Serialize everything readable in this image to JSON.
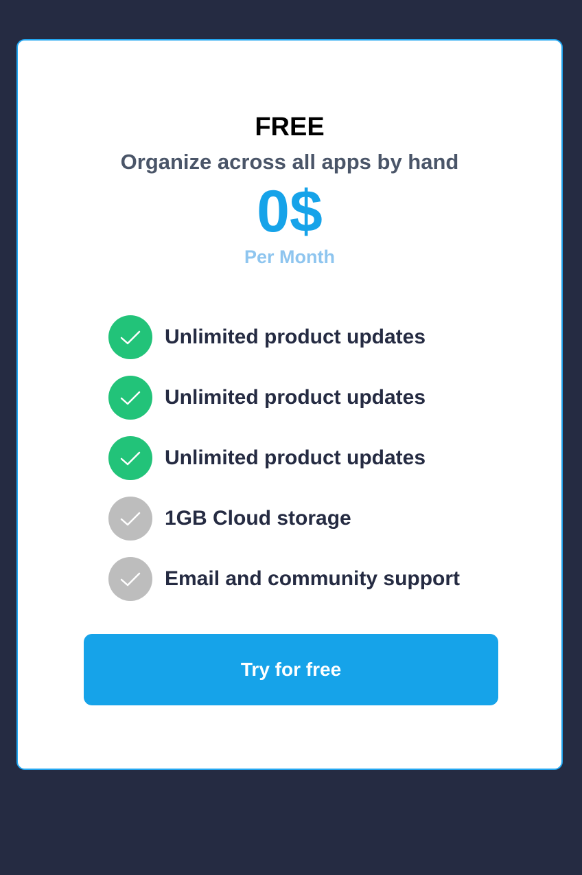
{
  "plan": {
    "name": "FREE",
    "subtitle": "Organize across all apps by hand",
    "price": "0$",
    "period": "Per Month"
  },
  "features": [
    {
      "label": "Unlimited product updates",
      "included": true,
      "icon": "check-icon"
    },
    {
      "label": "Unlimited product updates",
      "included": true,
      "icon": "check-icon"
    },
    {
      "label": "Unlimited product updates",
      "included": true,
      "icon": "check-icon"
    },
    {
      "label": "1GB Cloud storage",
      "included": false,
      "icon": "check-icon"
    },
    {
      "label": "Email and community support",
      "included": false,
      "icon": "check-icon"
    }
  ],
  "cta": {
    "label": "Try for free"
  },
  "colors": {
    "background": "#252b42",
    "card_border": "#23a6f0",
    "accent": "#16a3e9",
    "period": "#8ec5ef",
    "included": "#22c379",
    "excluded": "#bdbdbd",
    "text": "#252b42"
  }
}
